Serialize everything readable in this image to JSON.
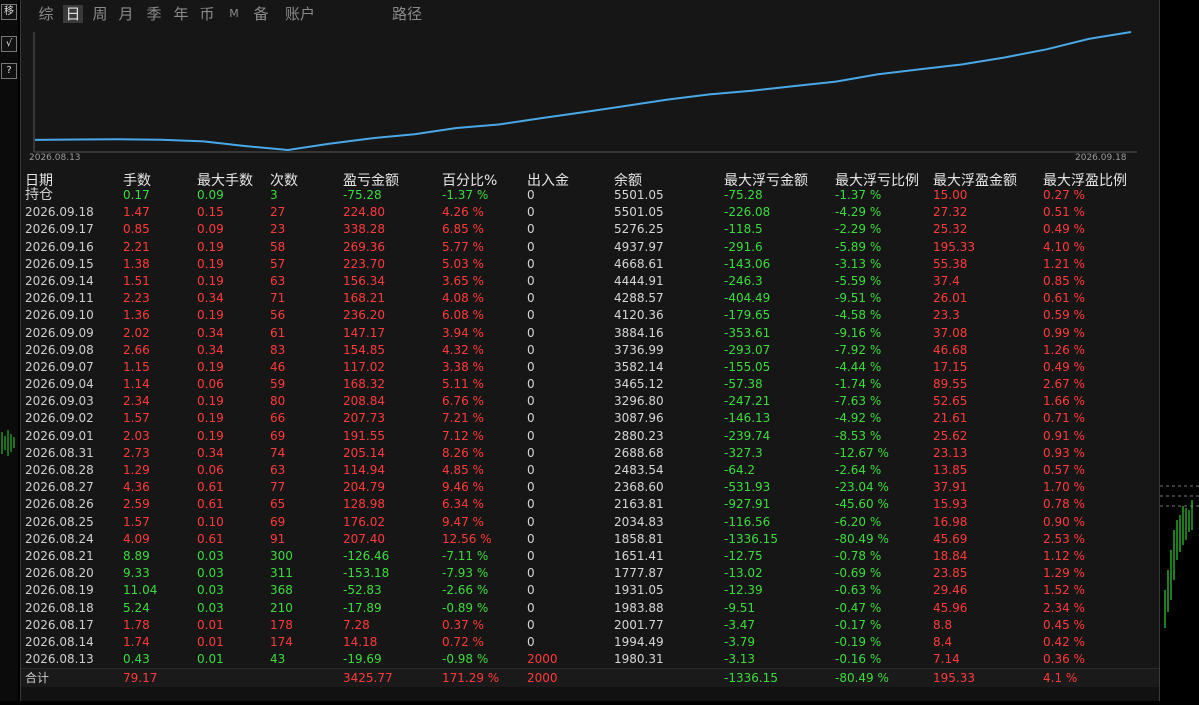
{
  "tabs": [
    "综",
    "日",
    "周",
    "月",
    "季",
    "年",
    "币",
    "M",
    "备",
    "账户",
    "路径"
  ],
  "left_tools": [
    "移",
    "√",
    "?"
  ],
  "chart": {
    "start_date": "2026.08.13",
    "end_date": "2026.09.18",
    "line_color": "#4aa8e8",
    "balance": [
      1980.31,
      1994.49,
      2001.77,
      1983.88,
      1931.05,
      1777.87,
      1651.41,
      1858.81,
      2034.83,
      2163.81,
      2368.6,
      2483.54,
      2688.68,
      2880.23,
      3087.96,
      3296.8,
      3465.12,
      3582.14,
      3736.99,
      3884.16,
      4120.36,
      4288.57,
      4444.91,
      4668.61,
      4937.97,
      5276.25,
      5501.05
    ]
  },
  "headers": [
    "日期",
    "手数",
    "最大手数",
    "次数",
    "盈亏金额",
    "百分比%",
    "出入金",
    "余额",
    "最大浮亏金额",
    "最大浮亏比例",
    "最大浮盈金额",
    "最大浮盈比例"
  ],
  "rows": [
    [
      "持仓",
      "0.17",
      "0.09",
      "3",
      "-75.28",
      "-1.37 %",
      "0",
      "5501.05",
      "-75.28",
      "-1.37 %",
      "15.00",
      "0.27 %"
    ],
    [
      "2026.09.18",
      "1.47",
      "0.15",
      "27",
      "224.80",
      "4.26 %",
      "0",
      "5501.05",
      "-226.08",
      "-4.29 %",
      "27.32",
      "0.51 %"
    ],
    [
      "2026.09.17",
      "0.85",
      "0.09",
      "23",
      "338.28",
      "6.85 %",
      "0",
      "5276.25",
      "-118.5",
      "-2.29 %",
      "25.32",
      "0.49 %"
    ],
    [
      "2026.09.16",
      "2.21",
      "0.19",
      "58",
      "269.36",
      "5.77 %",
      "0",
      "4937.97",
      "-291.6",
      "-5.89 %",
      "195.33",
      "4.10 %"
    ],
    [
      "2026.09.15",
      "1.38",
      "0.19",
      "57",
      "223.70",
      "5.03 %",
      "0",
      "4668.61",
      "-143.06",
      "-3.13 %",
      "55.38",
      "1.21 %"
    ],
    [
      "2026.09.14",
      "1.51",
      "0.19",
      "63",
      "156.34",
      "3.65 %",
      "0",
      "4444.91",
      "-246.3",
      "-5.59 %",
      "37.4",
      "0.85 %"
    ],
    [
      "2026.09.11",
      "2.23",
      "0.34",
      "71",
      "168.21",
      "4.08 %",
      "0",
      "4288.57",
      "-404.49",
      "-9.51 %",
      "26.01",
      "0.61 %"
    ],
    [
      "2026.09.10",
      "1.36",
      "0.19",
      "56",
      "236.20",
      "6.08 %",
      "0",
      "4120.36",
      "-179.65",
      "-4.58 %",
      "23.3",
      "0.59 %"
    ],
    [
      "2026.09.09",
      "2.02",
      "0.34",
      "61",
      "147.17",
      "3.94 %",
      "0",
      "3884.16",
      "-353.61",
      "-9.16 %",
      "37.08",
      "0.99 %"
    ],
    [
      "2026.09.08",
      "2.66",
      "0.34",
      "83",
      "154.85",
      "4.32 %",
      "0",
      "3736.99",
      "-293.07",
      "-7.92 %",
      "46.68",
      "1.26 %"
    ],
    [
      "2026.09.07",
      "1.15",
      "0.19",
      "46",
      "117.02",
      "3.38 %",
      "0",
      "3582.14",
      "-155.05",
      "-4.44 %",
      "17.15",
      "0.49 %"
    ],
    [
      "2026.09.04",
      "1.14",
      "0.06",
      "59",
      "168.32",
      "5.11 %",
      "0",
      "3465.12",
      "-57.38",
      "-1.74 %",
      "89.55",
      "2.67 %"
    ],
    [
      "2026.09.03",
      "2.34",
      "0.19",
      "80",
      "208.84",
      "6.76 %",
      "0",
      "3296.80",
      "-247.21",
      "-7.63 %",
      "52.65",
      "1.66 %"
    ],
    [
      "2026.09.02",
      "1.57",
      "0.19",
      "66",
      "207.73",
      "7.21 %",
      "0",
      "3087.96",
      "-146.13",
      "-4.92 %",
      "21.61",
      "0.71 %"
    ],
    [
      "2026.09.01",
      "2.03",
      "0.19",
      "69",
      "191.55",
      "7.12 %",
      "0",
      "2880.23",
      "-239.74",
      "-8.53 %",
      "25.62",
      "0.91 %"
    ],
    [
      "2026.08.31",
      "2.73",
      "0.34",
      "74",
      "205.14",
      "8.26 %",
      "0",
      "2688.68",
      "-327.3",
      "-12.67 %",
      "23.13",
      "0.93 %"
    ],
    [
      "2026.08.28",
      "1.29",
      "0.06",
      "63",
      "114.94",
      "4.85 %",
      "0",
      "2483.54",
      "-64.2",
      "-2.64 %",
      "13.85",
      "0.57 %"
    ],
    [
      "2026.08.27",
      "4.36",
      "0.61",
      "77",
      "204.79",
      "9.46 %",
      "0",
      "2368.60",
      "-531.93",
      "-23.04 %",
      "37.91",
      "1.70 %"
    ],
    [
      "2026.08.26",
      "2.59",
      "0.61",
      "65",
      "128.98",
      "6.34 %",
      "0",
      "2163.81",
      "-927.91",
      "-45.60 %",
      "15.93",
      "0.78 %"
    ],
    [
      "2026.08.25",
      "1.57",
      "0.10",
      "69",
      "176.02",
      "9.47 %",
      "0",
      "2034.83",
      "-116.56",
      "-6.20 %",
      "16.98",
      "0.90 %"
    ],
    [
      "2026.08.24",
      "4.09",
      "0.61",
      "91",
      "207.40",
      "12.56 %",
      "0",
      "1858.81",
      "-1336.15",
      "-80.49 %",
      "45.69",
      "2.53 %"
    ],
    [
      "2026.08.21",
      "8.89",
      "0.03",
      "300",
      "-126.46",
      "-7.11 %",
      "0",
      "1651.41",
      "-12.75",
      "-0.78 %",
      "18.84",
      "1.12 %"
    ],
    [
      "2026.08.20",
      "9.33",
      "0.03",
      "311",
      "-153.18",
      "-7.93 %",
      "0",
      "1777.87",
      "-13.02",
      "-0.69 %",
      "23.85",
      "1.29 %"
    ],
    [
      "2026.08.19",
      "11.04",
      "0.03",
      "368",
      "-52.83",
      "-2.66 %",
      "0",
      "1931.05",
      "-12.39",
      "-0.63 %",
      "29.46",
      "1.52 %"
    ],
    [
      "2026.08.18",
      "5.24",
      "0.03",
      "210",
      "-17.89",
      "-0.89 %",
      "0",
      "1983.88",
      "-9.51",
      "-0.47 %",
      "45.96",
      "2.34 %"
    ],
    [
      "2026.08.17",
      "1.78",
      "0.01",
      "178",
      "7.28",
      "0.37 %",
      "0",
      "2001.77",
      "-3.47",
      "-0.17 %",
      "8.8",
      "0.45 %"
    ],
    [
      "2026.08.14",
      "1.74",
      "0.01",
      "174",
      "14.18",
      "0.72 %",
      "0",
      "1994.49",
      "-3.79",
      "-0.19 %",
      "8.4",
      "0.42 %"
    ],
    [
      "2026.08.13",
      "0.43",
      "0.01",
      "43",
      "-19.69",
      "-0.98 %",
      "2000",
      "1980.31",
      "-3.13",
      "-0.16 %",
      "7.14",
      "0.36 %"
    ]
  ],
  "total": [
    "合计",
    "79.17",
    "",
    "",
    "3425.77",
    "171.29 %",
    "2000",
    "",
    "-1336.15",
    "-80.49 %",
    "195.33",
    "4.1 %"
  ]
}
